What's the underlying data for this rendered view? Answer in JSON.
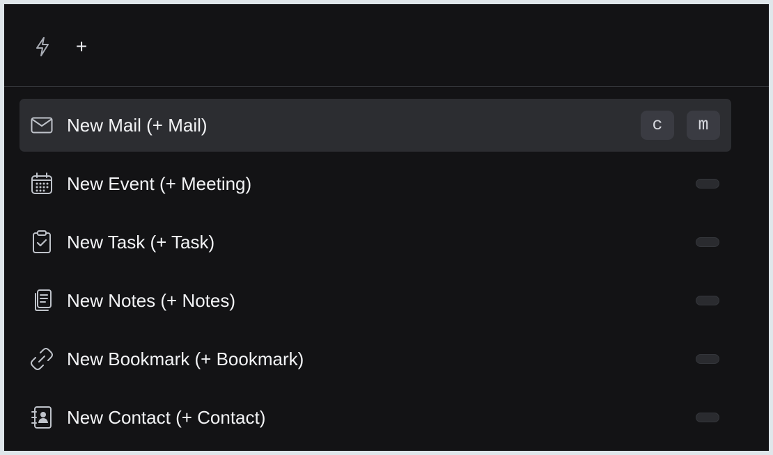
{
  "header": {
    "quick_icon": "bolt-icon",
    "add_glyph": "+"
  },
  "commands": [
    {
      "label": "New Mail (+ Mail)",
      "icon": "mail-icon",
      "shortcut": [
        "c",
        "m"
      ],
      "selected": true
    },
    {
      "label": "New Event (+ Meeting)",
      "icon": "calendar-icon",
      "shortcut": []
    },
    {
      "label": "New Task (+ Task)",
      "icon": "clipboard-check-icon",
      "shortcut": []
    },
    {
      "label": "New Notes (+ Notes)",
      "icon": "notes-icon",
      "shortcut": []
    },
    {
      "label": "New Bookmark (+ Bookmark)",
      "icon": "link-icon",
      "shortcut": []
    },
    {
      "label": "New Contact (+ Contact)",
      "icon": "contact-book-icon",
      "shortcut": []
    }
  ],
  "colors": {
    "background": "#131315",
    "selected_row": "#2c2d31",
    "text": "#f2f3f5",
    "icon": "#bfc3ca"
  }
}
